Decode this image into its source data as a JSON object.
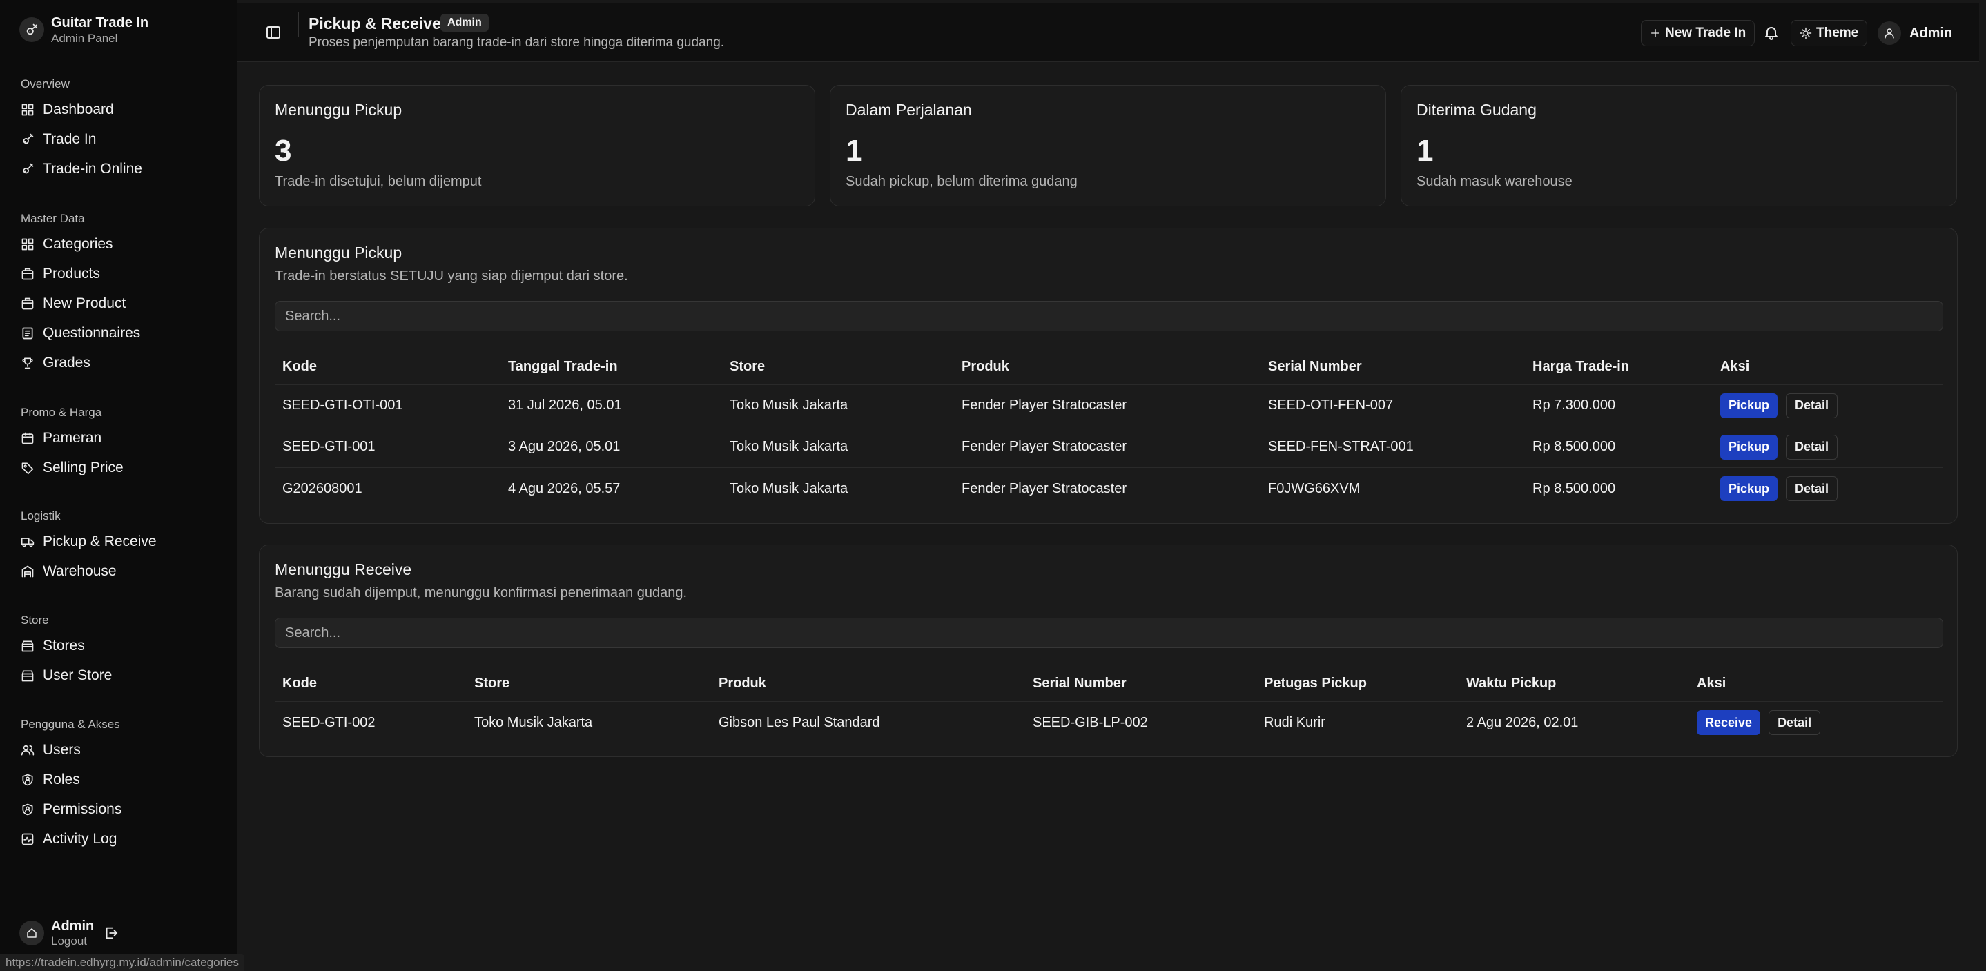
{
  "brand": {
    "title": "Guitar Trade In",
    "subtitle": "Admin Panel"
  },
  "sidebar": {
    "groups": [
      {
        "label": "Overview",
        "items": [
          {
            "label": "Dashboard",
            "icon": "grid-icon"
          },
          {
            "label": "Trade In",
            "icon": "guitar-icon"
          },
          {
            "label": "Trade-in Online",
            "icon": "guitar-icon"
          }
        ]
      },
      {
        "label": "Master Data",
        "items": [
          {
            "label": "Categories",
            "icon": "grid-icon"
          },
          {
            "label": "Products",
            "icon": "package-icon"
          },
          {
            "label": "New Product",
            "icon": "package-icon"
          },
          {
            "label": "Questionnaires",
            "icon": "clipboard-icon"
          },
          {
            "label": "Grades",
            "icon": "trophy-icon"
          }
        ]
      },
      {
        "label": "Promo & Harga",
        "items": [
          {
            "label": "Pameran",
            "icon": "calendar-icon"
          },
          {
            "label": "Selling Price",
            "icon": "tag-icon"
          }
        ]
      },
      {
        "label": "Logistik",
        "items": [
          {
            "label": "Pickup & Receive",
            "icon": "truck-icon"
          },
          {
            "label": "Warehouse",
            "icon": "warehouse-icon"
          }
        ]
      },
      {
        "label": "Store",
        "items": [
          {
            "label": "Stores",
            "icon": "store-icon"
          },
          {
            "label": "User Store",
            "icon": "store-icon"
          }
        ]
      },
      {
        "label": "Pengguna & Akses",
        "items": [
          {
            "label": "Users",
            "icon": "users-icon"
          },
          {
            "label": "Roles",
            "icon": "shield-icon"
          },
          {
            "label": "Permissions",
            "icon": "shield-icon"
          },
          {
            "label": "Activity Log",
            "icon": "activity-icon"
          }
        ]
      }
    ],
    "footer": {
      "name": "Admin",
      "action": "Logout"
    }
  },
  "status_url": "https://tradein.edhyrg.my.id/admin/categories",
  "header": {
    "title": "Pickup & Receive",
    "badge": "Admin",
    "description": "Proses penjemputan barang trade-in dari store hingga diterima gudang.",
    "new_trade_in": "New Trade In",
    "theme": "Theme",
    "user": "Admin"
  },
  "stats": [
    {
      "title": "Menunggu Pickup",
      "value": "3",
      "desc": "Trade-in disetujui, belum dijemput"
    },
    {
      "title": "Dalam Perjalanan",
      "value": "1",
      "desc": "Sudah pickup, belum diterima gudang"
    },
    {
      "title": "Diterima Gudang",
      "value": "1",
      "desc": "Sudah masuk warehouse"
    }
  ],
  "pickup": {
    "title": "Menunggu Pickup",
    "desc": "Trade-in berstatus SETUJU yang siap dijemput dari store.",
    "search_placeholder": "Search...",
    "columns": [
      "Kode",
      "Tanggal Trade-in",
      "Store",
      "Produk",
      "Serial Number",
      "Harga Trade-in",
      "Aksi"
    ],
    "rows": [
      {
        "kode": "SEED-GTI-OTI-001",
        "tanggal": "31 Jul 2026, 05.01",
        "store": "Toko Musik Jakarta",
        "produk": "Fender Player Stratocaster",
        "serial": "SEED-OTI-FEN-007",
        "harga": "Rp 7.300.000"
      },
      {
        "kode": "SEED-GTI-001",
        "tanggal": "3 Agu 2026, 05.01",
        "store": "Toko Musik Jakarta",
        "produk": "Fender Player Stratocaster",
        "serial": "SEED-FEN-STRAT-001",
        "harga": "Rp 8.500.000"
      },
      {
        "kode": "G202608001",
        "tanggal": "4 Agu 2026, 05.57",
        "store": "Toko Musik Jakarta",
        "produk": "Fender Player Stratocaster",
        "serial": "F0JWG66XVM",
        "harga": "Rp 8.500.000"
      }
    ],
    "action_primary": "Pickup",
    "action_secondary": "Detail"
  },
  "receive": {
    "title": "Menunggu Receive",
    "desc": "Barang sudah dijemput, menunggu konfirmasi penerimaan gudang.",
    "search_placeholder": "Search...",
    "columns": [
      "Kode",
      "Store",
      "Produk",
      "Serial Number",
      "Petugas Pickup",
      "Waktu Pickup",
      "Aksi"
    ],
    "rows": [
      {
        "kode": "SEED-GTI-002",
        "store": "Toko Musik Jakarta",
        "produk": "Gibson Les Paul Standard",
        "serial": "SEED-GIB-LP-002",
        "petugas": "Rudi Kurir",
        "waktu": "2 Agu 2026, 02.01"
      }
    ],
    "action_primary": "Receive",
    "action_secondary": "Detail"
  },
  "colors": {
    "primary_button": "#1d3fbf",
    "sidebar_bg": "#0c0c0c",
    "content_bg": "#181818"
  }
}
